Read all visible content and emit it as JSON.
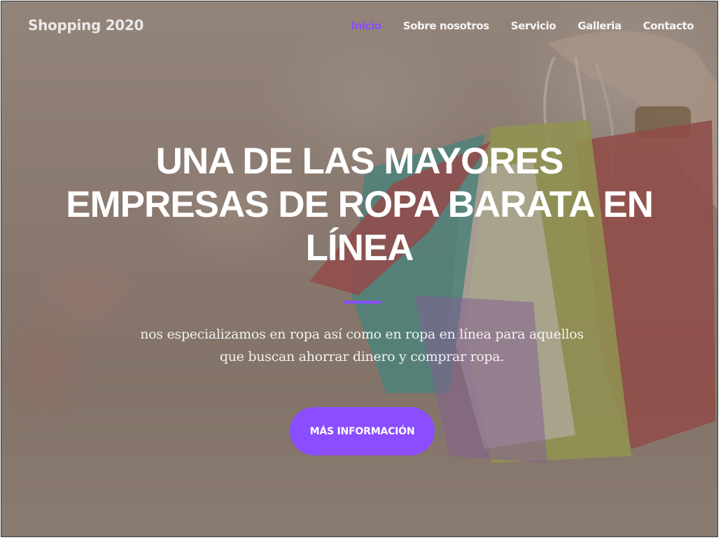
{
  "brand": "Shopping 2020",
  "nav": {
    "items": [
      {
        "label": "Inicio",
        "active": true
      },
      {
        "label": "Sobre nosotros",
        "active": false
      },
      {
        "label": "Servicio",
        "active": false
      },
      {
        "label": "Galleria",
        "active": false
      },
      {
        "label": "Contacto",
        "active": false
      }
    ]
  },
  "hero": {
    "title_line1": "UNA DE LAS MAYORES",
    "title_line2": "EMPRESAS DE ROPA BARATA EN",
    "title_line3": "LÍNEA",
    "subtitle_line1": "nos especializamos en ropa así como en ropa en línea para aquellos",
    "subtitle_line2": "que buscan ahorrar dinero y comprar ropa.",
    "cta_label": "MÁS INFORMACIÓN"
  },
  "colors": {
    "accent": "#8a4dff",
    "text": "#ffffff"
  },
  "icons": []
}
